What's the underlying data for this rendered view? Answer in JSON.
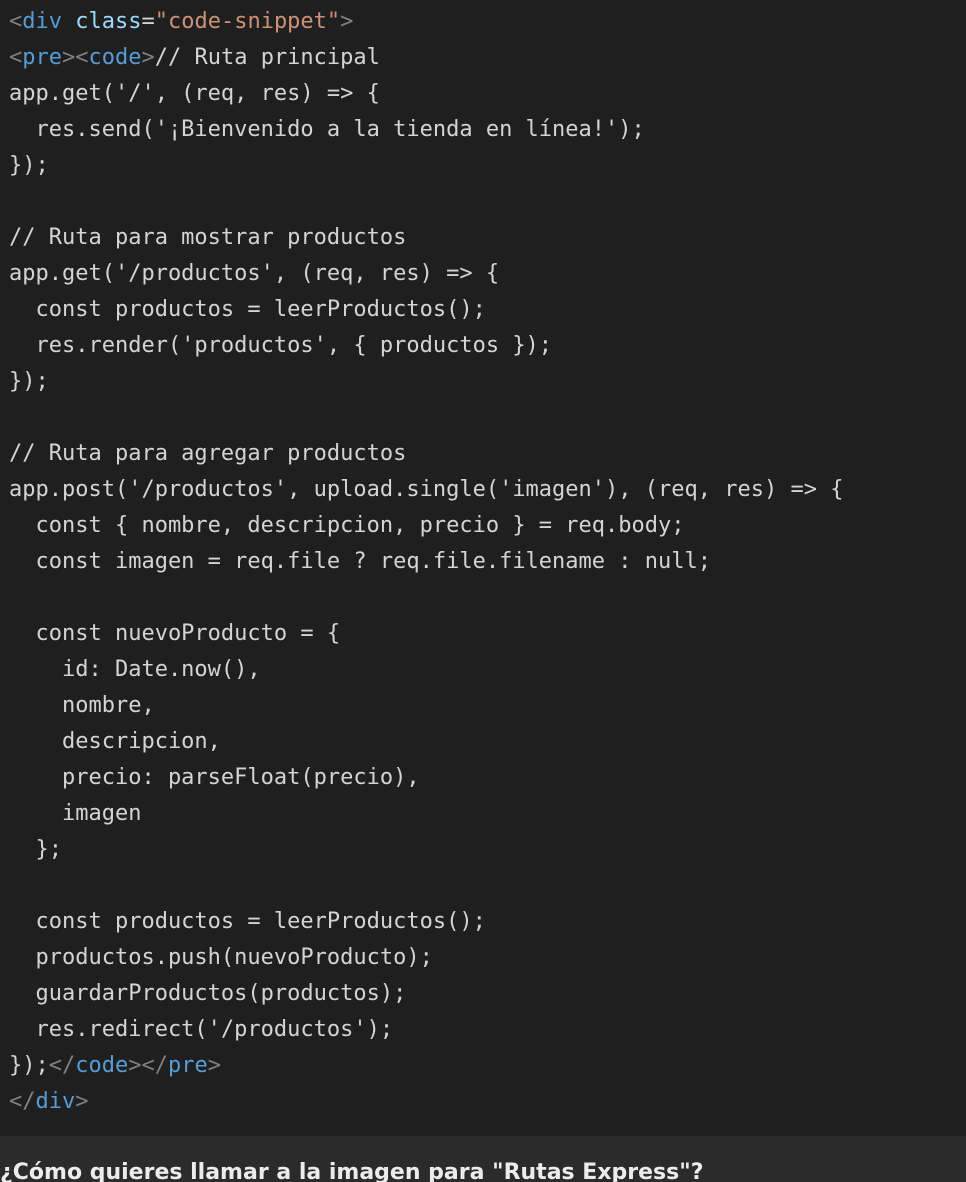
{
  "snippet": {
    "open_div_bracket": "<",
    "open_div_tag": "div",
    "open_div_attr": " class",
    "open_div_eq": "=",
    "open_div_value": "\"code-snippet\"",
    "open_div_close": ">",
    "pre_open_bracket": "<",
    "pre_open_tag": "pre",
    "pre_open_close": ">",
    "code_open_bracket": "<",
    "code_open_tag": "code",
    "code_open_close": ">",
    "first_code_text": "// Ruta principal",
    "body_lines": [
      "app.get('/', (req, res) => {",
      "  res.send('¡Bienvenido a la tienda en línea!');",
      "});",
      "",
      "// Ruta para mostrar productos",
      "app.get('/productos', (req, res) => {",
      "  const productos = leerProductos();",
      "  res.render('productos', { productos });",
      "});",
      "",
      "// Ruta para agregar productos",
      "app.post('/productos', upload.single('imagen'), (req, res) => {",
      "  const { nombre, descripcion, precio } = req.body;",
      "  const imagen = req.file ? req.file.filename : null;",
      "",
      "  const nuevoProducto = {",
      "    id: Date.now(),",
      "    nombre,",
      "    descripcion,",
      "    precio: parseFloat(precio),",
      "    imagen",
      "  };",
      "",
      "  const productos = leerProductos();",
      "  productos.push(nuevoProducto);",
      "  guardarProductos(productos);",
      "  res.redirect('/productos');"
    ],
    "last_code_text": "});",
    "code_close_open": "</",
    "code_close_tag": "code",
    "code_close_end": ">",
    "pre_close_open": "</",
    "pre_close_tag": "pre",
    "pre_close_end": ">",
    "div_close_open": "</",
    "div_close_tag": "div",
    "div_close_end": ">"
  },
  "footer": {
    "prompt": "¿Cómo quieres llamar a la imagen para \"Rutas Express\"?"
  }
}
